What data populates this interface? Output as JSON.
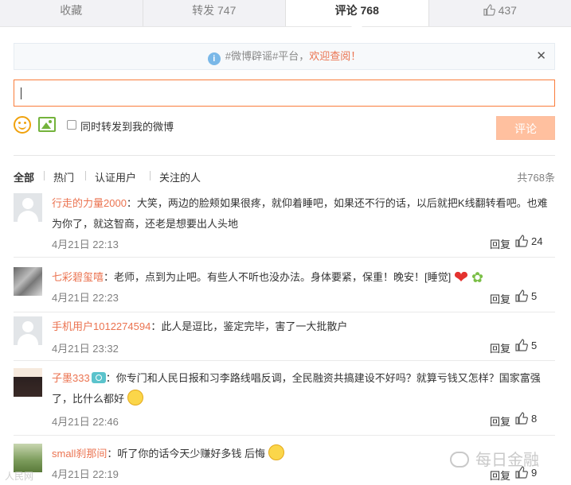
{
  "tabs": [
    {
      "label": "收藏"
    },
    {
      "label": "转发 747"
    },
    {
      "label": "评论 768"
    },
    {
      "label": "437",
      "icon": "thumbs-up-icon"
    }
  ],
  "notice": {
    "prefix": "#微博辟谣#平台，",
    "highlight": "欢迎查阅！",
    "close": "✕"
  },
  "composer": {
    "input_value": "",
    "checkbox_label": "同时转发到我的微博",
    "submit_label": "评论"
  },
  "filters": {
    "all": "全部",
    "hot": "热门",
    "verified": "认证用户",
    "following": "关注的人",
    "total": "共768条"
  },
  "comments": [
    {
      "user": "行走的力量2000",
      "text": "：大笑，两边的脸颊如果很疼，就仰着睡吧，如果还不行的话，以后就把K线翻转看吧。也难为你了，就这智商，还老是想要出人头地",
      "time": "4月21日 22:13",
      "reply": "回复",
      "likes": "24"
    },
    {
      "user": "七彩碧玺嘻",
      "text": "：老师，点到为止吧。有些人不听也没办法。身体要紧，保重！晚安！[睡觉]",
      "time": "4月21日 22:23",
      "reply": "回复",
      "likes": "5"
    },
    {
      "user": "手机用户1012274594",
      "text": "：此人是逗比，鉴定完毕，害了一大批散户",
      "time": "4月21日 23:32",
      "reply": "回复",
      "likes": "5"
    },
    {
      "user": "子墨333",
      "text": "：你专门和人民日报和习李路线唱反调，全民融资共搞建设不好吗？就算亏钱又怎样？国家富强了，比什么都好",
      "time": "4月21日 22:46",
      "reply": "回复",
      "likes": "8"
    },
    {
      "user": "small刹那间",
      "text": "：听了你的话今天少赚好多钱 后悔",
      "time": "4月21日 22:19",
      "reply": "回复",
      "likes": "9"
    }
  ],
  "watermark": {
    "text": "每日金融"
  },
  "corner_mark": {
    "text": "人民网"
  },
  "colors": {
    "accent": "#eb7350",
    "input_border": "#fa7d3c",
    "submit_bg": "#ffc09f"
  }
}
